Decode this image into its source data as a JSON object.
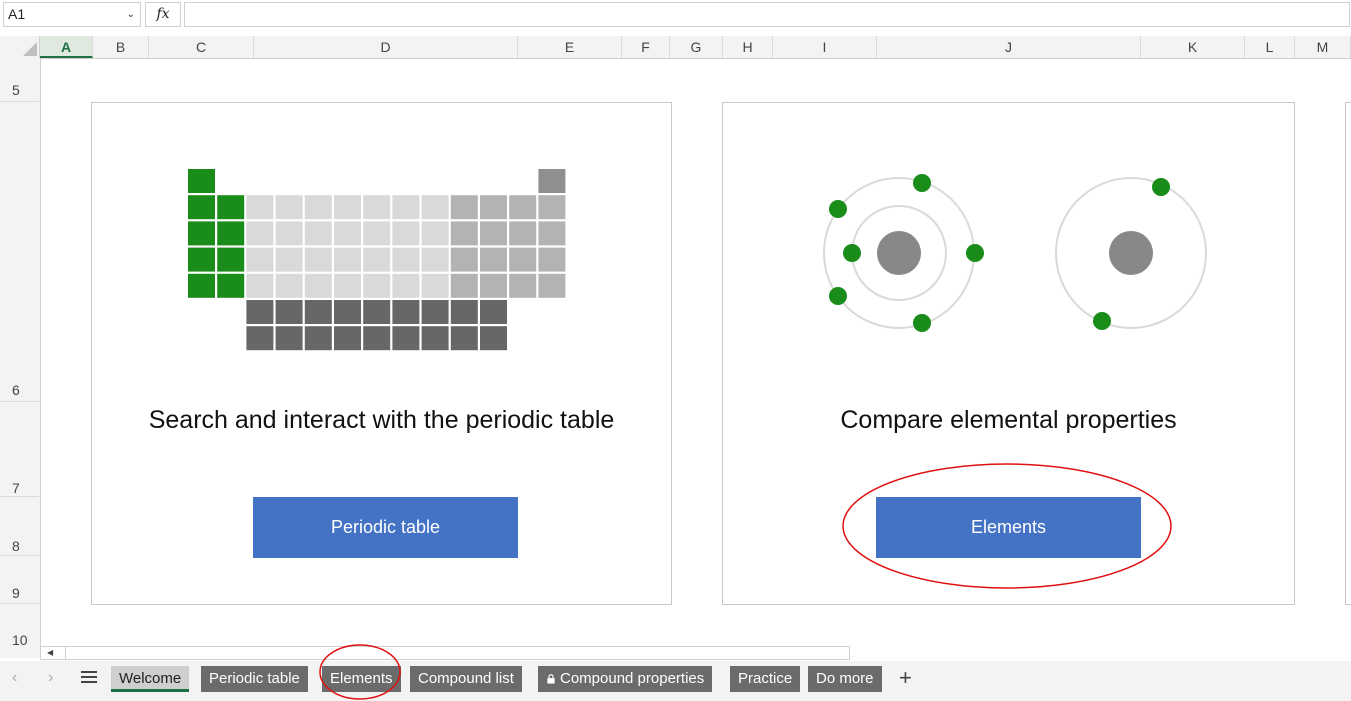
{
  "formula_bar": {
    "name_box": "A1",
    "fx_label": "fx",
    "formula": ""
  },
  "columns": [
    "A",
    "B",
    "C",
    "D",
    "E",
    "F",
    "G",
    "H",
    "I",
    "J",
    "K",
    "L",
    "M"
  ],
  "rows": [
    "5",
    "6",
    "7",
    "8",
    "9",
    "10"
  ],
  "cards": [
    {
      "title": "Search and interact with the periodic table",
      "button": "Periodic table"
    },
    {
      "title": "Compare elemental properties",
      "button": "Elements"
    }
  ],
  "sheet_tabs": [
    {
      "label": "Welcome",
      "active": true
    },
    {
      "label": "Periodic table"
    },
    {
      "label": "Elements"
    },
    {
      "label": "Compound list"
    },
    {
      "label": "Compound properties",
      "locked": true
    },
    {
      "label": "Practice"
    },
    {
      "label": "Do more"
    }
  ],
  "colors": {
    "accent_green": "#1e7145",
    "button_blue": "#4472c4",
    "icon_green": "#1a8c1a",
    "annotation_red": "#e01010"
  }
}
